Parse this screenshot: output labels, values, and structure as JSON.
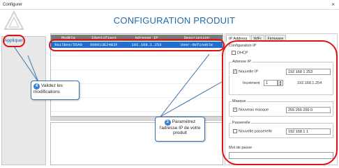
{
  "window": {
    "title": "Configurer",
    "close_glyph": "×"
  },
  "header": {
    "title": "CONFIGURATION PRODUIT"
  },
  "sidebar": {
    "apply_label": "Appliquer"
  },
  "table": {
    "columns": [
      "Modèle",
      "Identifiant",
      "Adresse IP",
      "Description"
    ],
    "rows": [
      [
        "RailBox/55A0",
        "000013E24B3F",
        "192.168.1.253",
        "User-definable"
      ]
    ]
  },
  "tabs": [
    "IP Address",
    "WiFi",
    "Firmware"
  ],
  "config": {
    "group_title": "Configuration IP",
    "dhcp_label": "DHCP",
    "ip_group": "Adresse IP",
    "new_ip_label": "Nouvelle IP",
    "new_ip_value": "192  168  1  253",
    "increment_label": "Incrément",
    "increment_value": "1",
    "increment_result": "192.168.1.254",
    "mask_group": "Masque",
    "new_mask_label": "Nouveau masque",
    "new_mask_value": "255  255  255  0",
    "gateway_group": "Passerelle",
    "new_gateway_label": "Nouvelle passerelle",
    "new_gateway_value": "192  168  1  1",
    "password_label": "Mot de passe"
  },
  "callouts": {
    "step4_num": "4",
    "step4_text": "Validez les modifications",
    "step3_num": "3",
    "step3_text": "Paramétrez l'adresse IP de votre produit"
  },
  "colors": {
    "accent": "#1f6aa8",
    "selected_row": "#1e6fd0",
    "highlight": "#e01010"
  }
}
